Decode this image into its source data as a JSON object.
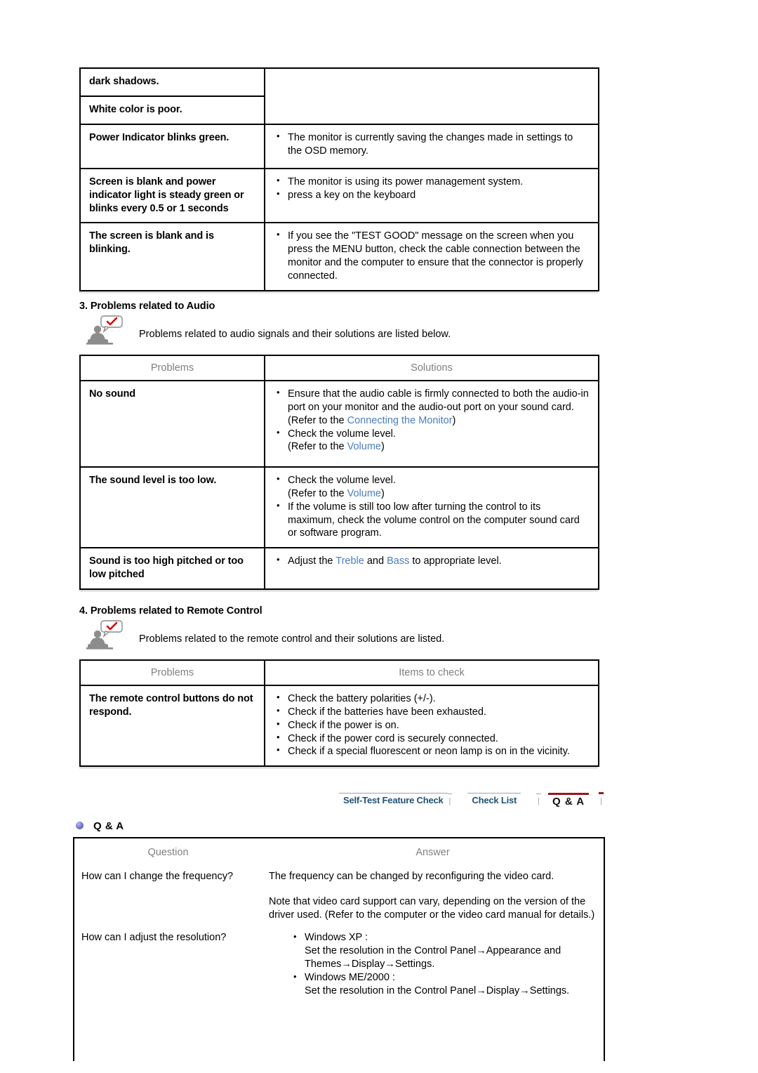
{
  "video_table": {
    "rows": [
      {
        "problem": "dark shadows.",
        "solutions": []
      },
      {
        "problem": "White color is poor.",
        "solutions": []
      },
      {
        "problem": "Power Indicator blinks green.",
        "solutions": [
          "The monitor is currently saving the changes made in settings to the OSD memory."
        ]
      },
      {
        "problem": "Screen is blank and power indicator light is steady green or blinks every 0.5 or 1 seconds",
        "solutions": [
          "The monitor is using its power management system.",
          "press a key on the keyboard"
        ]
      },
      {
        "problem": "The screen is blank and is blinking.",
        "solutions": [
          "If you see the \"TEST GOOD\" message on the screen when you press the MENU button, check the cable connection between the monitor and the computer to ensure that the connector is properly connected."
        ]
      }
    ]
  },
  "audio_section": {
    "heading": "3. Problems related to Audio",
    "note": "Problems related to audio signals and their solutions are listed below.",
    "table": {
      "header_problems": "Problems",
      "header_solutions": "Solutions",
      "rows": [
        {
          "problem": "No sound",
          "bullets": [
            {
              "text": "Ensure that the audio cable is firmly connected to both the audio-in port on your monitor and the audio-out port on your sound card.",
              "sub_prefix": "(Refer to the ",
              "sub_link": "Connecting the Monitor",
              "sub_suffix": ")"
            },
            {
              "text": "Check the volume level.",
              "sub_prefix": "(Refer to the ",
              "sub_link": "Volume",
              "sub_suffix": ")"
            }
          ]
        },
        {
          "problem": "The sound level is too low.",
          "bullets": [
            {
              "text": "Check the volume level.",
              "sub_prefix": "(Refer to the ",
              "sub_link": "Volume",
              "sub_suffix": ")"
            },
            {
              "text": "If the volume is still too low after turning the control to its maximum, check the volume control on the computer sound card or software program.",
              "sub_prefix": "",
              "sub_link": "",
              "sub_suffix": ""
            }
          ]
        },
        {
          "problem": "Sound is too high pitched or too low pitched",
          "treble_line": {
            "a": "Adjust the ",
            "link1": "Treble",
            "b": " and ",
            "link2": "Bass",
            "c": " to appropriate level."
          }
        }
      ]
    }
  },
  "remote_section": {
    "heading": "4. Problems related to Remote Control",
    "note": "Problems related to the remote control and their solutions are listed.",
    "table": {
      "header_problems": "Problems",
      "header_items": "Items to check",
      "problem": "The remote control buttons do not respond.",
      "bullets": [
        "Check the battery polarities (+/-).",
        "Check if the batteries have been exhausted.",
        "Check if the power is on.",
        "Check if the power cord is securely connected.",
        "Check if a special fluorescent or neon lamp is on in the vicinity."
      ]
    }
  },
  "navbar": {
    "items": [
      {
        "label": "Self-Test Feature Check",
        "active": false
      },
      {
        "label": "Check List",
        "active": false
      },
      {
        "label": "Q & A",
        "active": true
      }
    ],
    "separator": "|",
    "active_underline_color": "#9c1420",
    "link_color": "#1f5275"
  },
  "qa_section": {
    "heading": "Q & A",
    "header_question": "Question",
    "header_answer": "Answer",
    "rows": [
      {
        "question": "How can I change the frequency?",
        "answer_para1": "The frequency can be changed by reconfiguring the video card.",
        "answer_para2": "Note that video card support can vary, depending on the version of the driver used. (Refer to the computer or the video card manual for details.)"
      },
      {
        "question": "How can I adjust the resolution?",
        "bullets": [
          {
            "title": "Windows XP :",
            "detail": "Set the resolution in the Control Panel→Appearance and Themes→Display→Settings."
          },
          {
            "title": "Windows ME/2000 :",
            "detail": "Set the resolution in the Control Panel→Display→Settings."
          }
        ]
      }
    ]
  },
  "icons": {
    "person_check": "person-with-check-bubble-icon",
    "orb": "bullet-orb-icon"
  },
  "colors": {
    "link_blue": "#4a7ebb",
    "header_gray": "#808080",
    "nav_active_red": "#9c1420",
    "nav_blue": "#1f5275"
  }
}
